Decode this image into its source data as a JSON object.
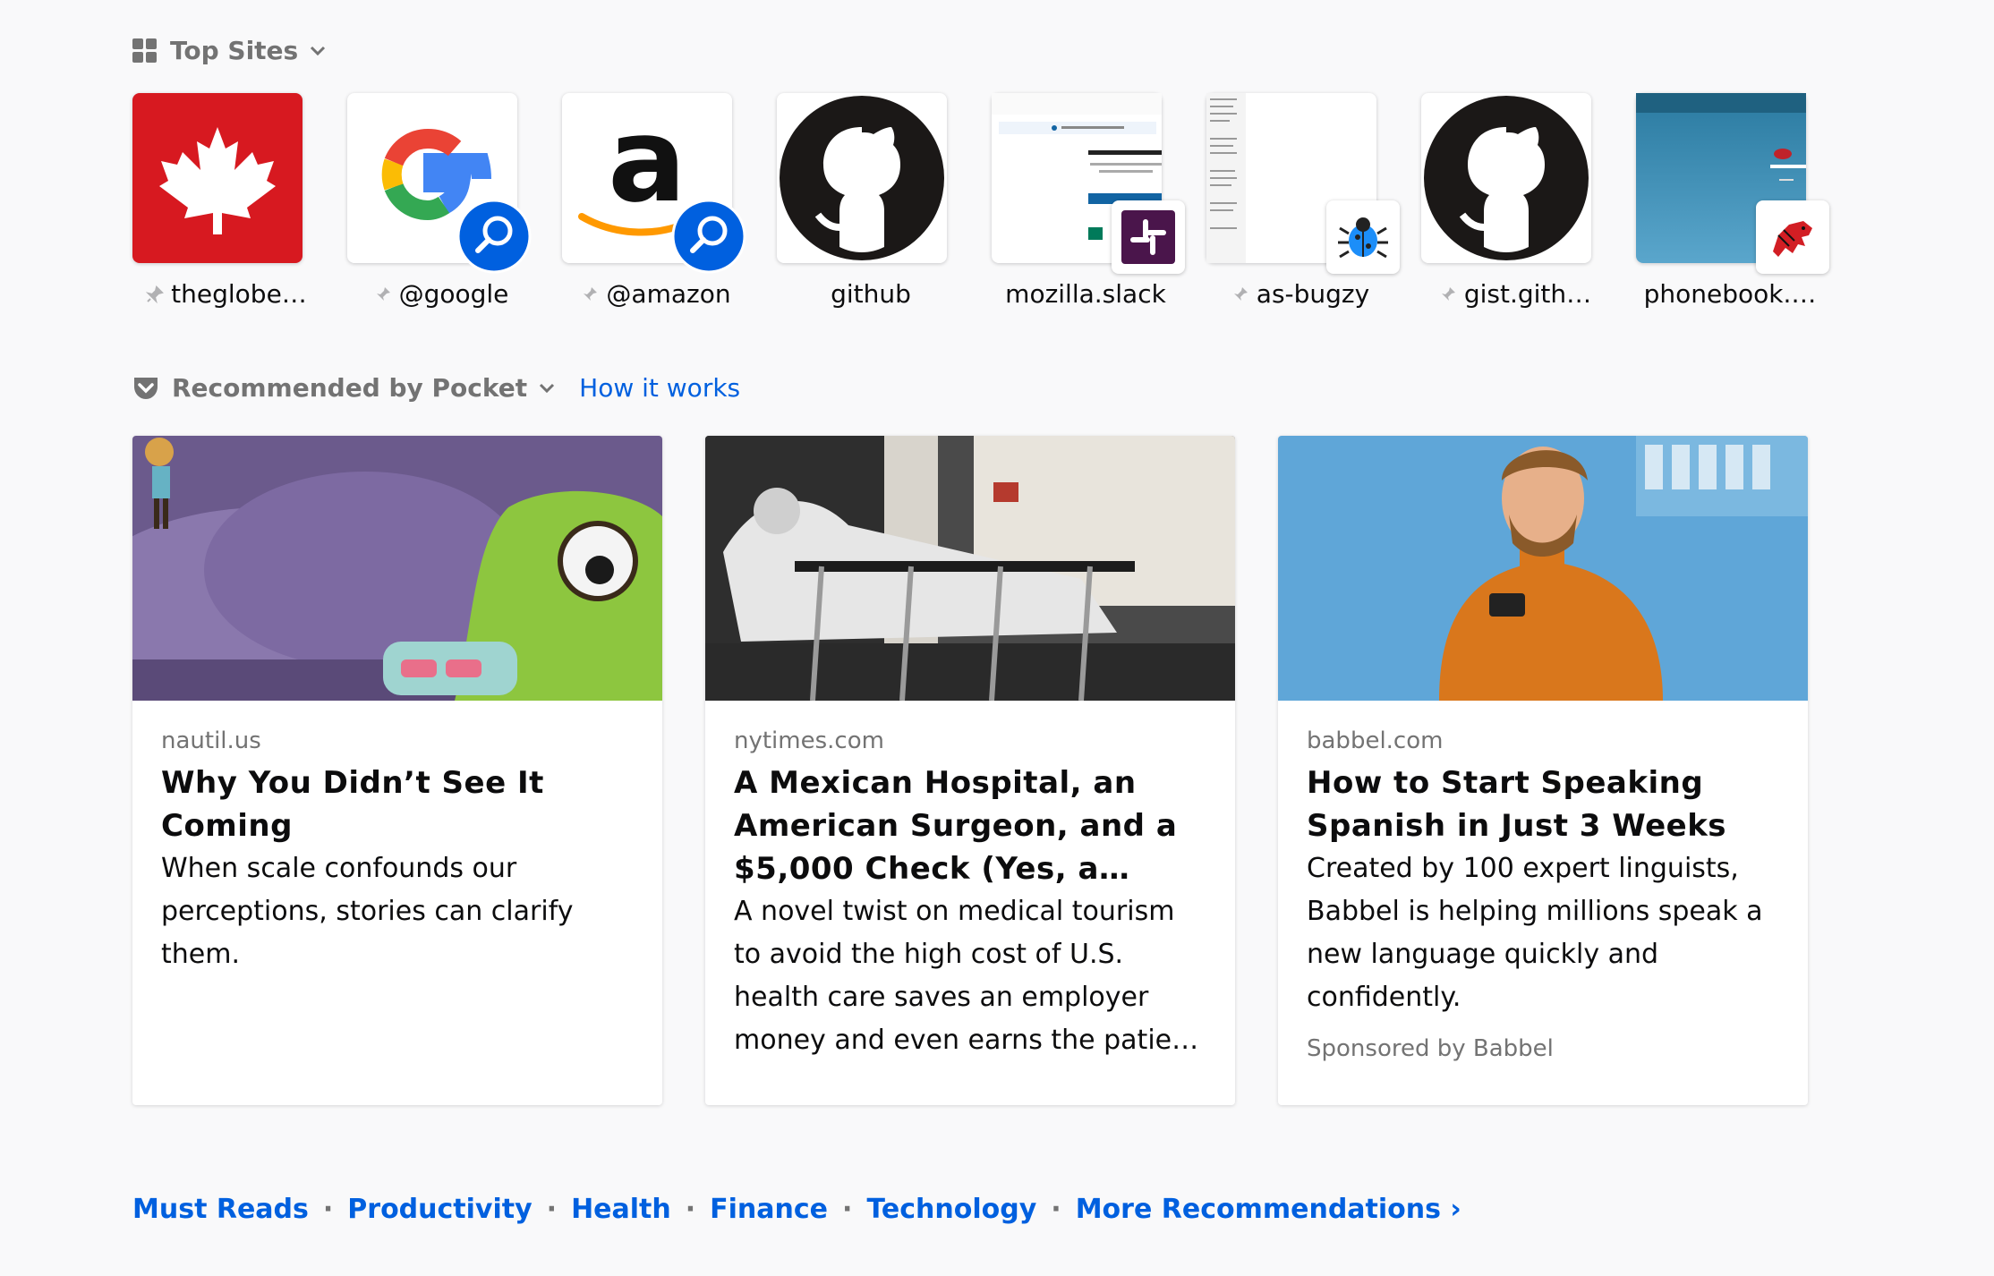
{
  "top_sites": {
    "heading": "Top Sites",
    "tiles": [
      {
        "label": "theglobe…"
      },
      {
        "label": "@google"
      },
      {
        "label": "@amazon"
      },
      {
        "label": "github"
      },
      {
        "label": "mozilla.slack"
      },
      {
        "label": "as-bugzy"
      },
      {
        "label": "gist.gith…"
      },
      {
        "label": "phonebook.…"
      }
    ]
  },
  "pocket": {
    "heading": "Recommended by Pocket",
    "how_it_works": "How it works",
    "cards": [
      {
        "source": "nautil.us",
        "title": "Why You Didn’t See It Coming",
        "excerpt": "When scale confounds our perceptions, stories can clarify them.",
        "sponsor": ""
      },
      {
        "source": "nytimes.com",
        "title": "A Mexican Hospital, an American Surgeon, and a $5,000 Check (Yes, a…",
        "excerpt": "A novel twist on medical tourism to avoid the high cost of U.S. health care saves an employer money and even earns the patie…",
        "sponsor": ""
      },
      {
        "source": "babbel.com",
        "title": "How to Start Speaking Spanish in Just 3 Weeks",
        "excerpt": "Created by 100 expert linguists, Babbel is helping millions speak a new language quickly and confidently.",
        "sponsor": "Sponsored by Babbel"
      }
    ],
    "topics": [
      "Must Reads",
      "Productivity",
      "Health",
      "Finance",
      "Technology"
    ],
    "more": "More Recommendations ›"
  },
  "colors": {
    "link": "#0060df",
    "muted": "#737373",
    "background": "#f9f9fa",
    "globe_red": "#d71920"
  }
}
